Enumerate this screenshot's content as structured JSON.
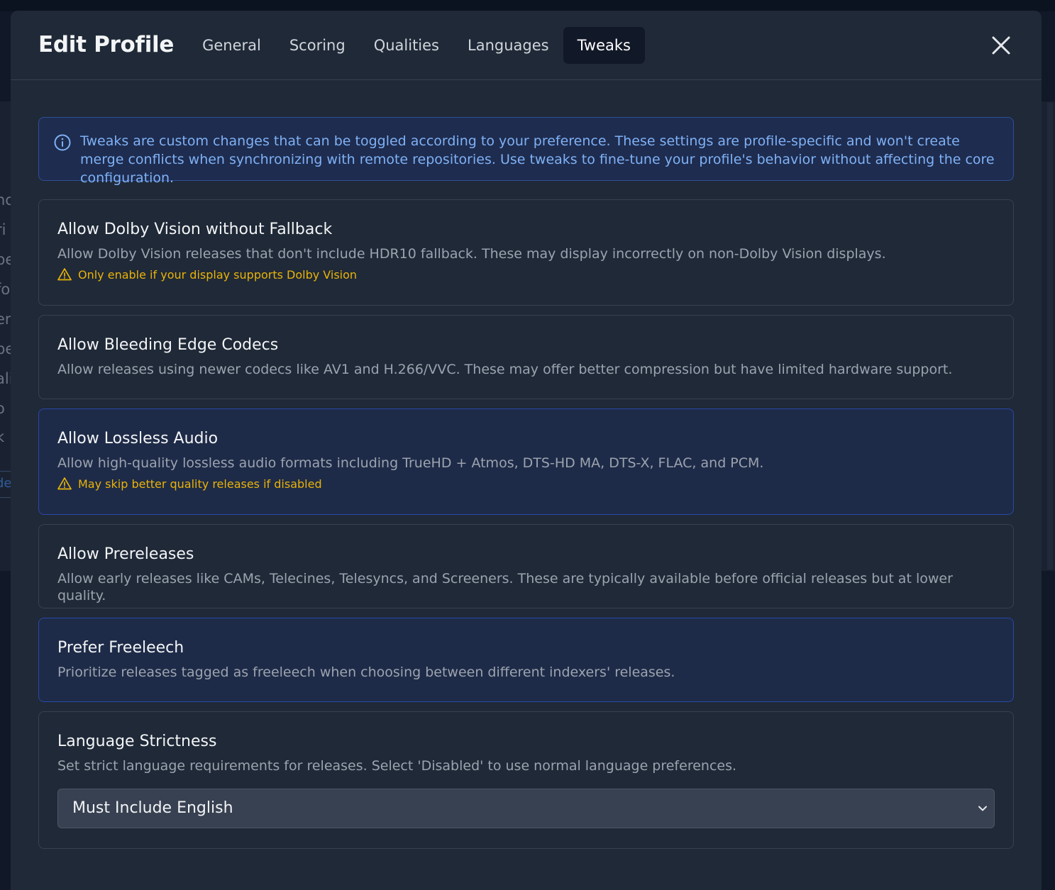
{
  "backdrop": {
    "fragments": [
      "nc",
      "ri",
      "pe",
      "fo",
      "er",
      "pe",
      "ali",
      "o",
      "k",
      "de"
    ]
  },
  "modal": {
    "title": "Edit Profile",
    "tabs": [
      {
        "label": "General",
        "active": false
      },
      {
        "label": "Scoring",
        "active": false
      },
      {
        "label": "Qualities",
        "active": false
      },
      {
        "label": "Languages",
        "active": false
      },
      {
        "label": "Tweaks",
        "active": true
      }
    ],
    "close_icon": "close-icon"
  },
  "info": {
    "icon": "info-icon",
    "text": "Tweaks are custom changes that can be toggled according to your preference. These settings are profile-specific and won't create merge conflicts when synchronizing with remote repositories. Use tweaks to fine-tune your profile's behavior without affecting the core configuration."
  },
  "tweaks": [
    {
      "title": "Allow Dolby Vision without Fallback",
      "description": "Allow Dolby Vision releases that don't include HDR10 fallback. These may display incorrectly on non-Dolby Vision displays.",
      "warning": "Only enable if your display supports Dolby Vision",
      "enabled": false
    },
    {
      "title": "Allow Bleeding Edge Codecs",
      "description": "Allow releases using newer codecs like AV1 and H.266/VVC. These may offer better compression but have limited hardware support.",
      "enabled": false
    },
    {
      "title": "Allow Lossless Audio",
      "description": "Allow high-quality lossless audio formats including TrueHD + Atmos, DTS-HD MA, DTS-X, FLAC, and PCM.",
      "warning": "May skip better quality releases if disabled",
      "enabled": true
    },
    {
      "title": "Allow Prereleases",
      "description": "Allow early releases like CAMs, Telecines, Telesyncs, and Screeners. These are typically available before official releases but at lower quality.",
      "enabled": false
    },
    {
      "title": "Prefer Freeleech",
      "description": "Prioritize releases tagged as freeleech when choosing between different indexers' releases.",
      "enabled": true
    }
  ],
  "language_strictness": {
    "title": "Language Strictness",
    "description": "Set strict language requirements for releases. Select 'Disabled' to use normal language preferences.",
    "selected": "Must Include English"
  },
  "colors": {
    "accent": "#2a47a8",
    "warning": "#eab308",
    "info_text": "#7fb1f5"
  }
}
